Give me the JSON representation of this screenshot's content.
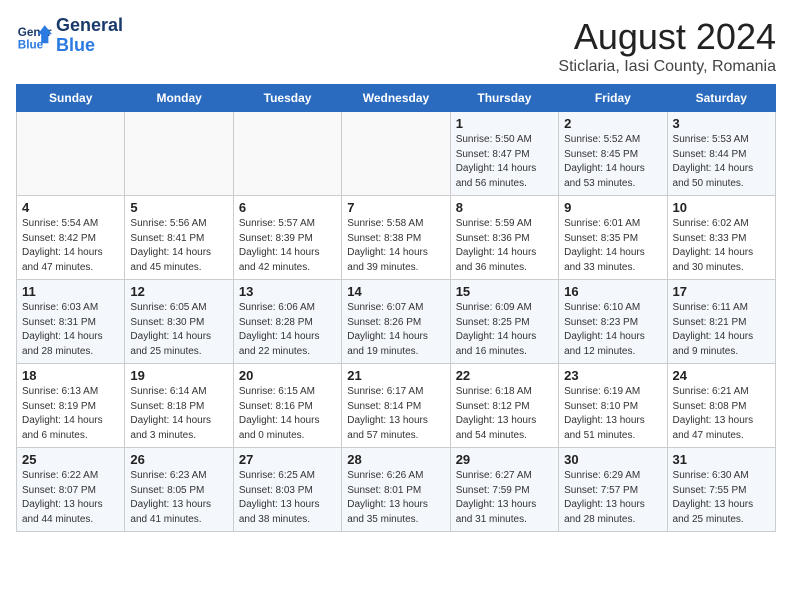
{
  "header": {
    "logo_line1": "General",
    "logo_line2": "Blue",
    "title": "August 2024",
    "subtitle": "Sticlaria, Iasi County, Romania"
  },
  "weekdays": [
    "Sunday",
    "Monday",
    "Tuesday",
    "Wednesday",
    "Thursday",
    "Friday",
    "Saturday"
  ],
  "weeks": [
    [
      {
        "num": "",
        "detail": ""
      },
      {
        "num": "",
        "detail": ""
      },
      {
        "num": "",
        "detail": ""
      },
      {
        "num": "",
        "detail": ""
      },
      {
        "num": "1",
        "detail": "Sunrise: 5:50 AM\nSunset: 8:47 PM\nDaylight: 14 hours\nand 56 minutes."
      },
      {
        "num": "2",
        "detail": "Sunrise: 5:52 AM\nSunset: 8:45 PM\nDaylight: 14 hours\nand 53 minutes."
      },
      {
        "num": "3",
        "detail": "Sunrise: 5:53 AM\nSunset: 8:44 PM\nDaylight: 14 hours\nand 50 minutes."
      }
    ],
    [
      {
        "num": "4",
        "detail": "Sunrise: 5:54 AM\nSunset: 8:42 PM\nDaylight: 14 hours\nand 47 minutes."
      },
      {
        "num": "5",
        "detail": "Sunrise: 5:56 AM\nSunset: 8:41 PM\nDaylight: 14 hours\nand 45 minutes."
      },
      {
        "num": "6",
        "detail": "Sunrise: 5:57 AM\nSunset: 8:39 PM\nDaylight: 14 hours\nand 42 minutes."
      },
      {
        "num": "7",
        "detail": "Sunrise: 5:58 AM\nSunset: 8:38 PM\nDaylight: 14 hours\nand 39 minutes."
      },
      {
        "num": "8",
        "detail": "Sunrise: 5:59 AM\nSunset: 8:36 PM\nDaylight: 14 hours\nand 36 minutes."
      },
      {
        "num": "9",
        "detail": "Sunrise: 6:01 AM\nSunset: 8:35 PM\nDaylight: 14 hours\nand 33 minutes."
      },
      {
        "num": "10",
        "detail": "Sunrise: 6:02 AM\nSunset: 8:33 PM\nDaylight: 14 hours\nand 30 minutes."
      }
    ],
    [
      {
        "num": "11",
        "detail": "Sunrise: 6:03 AM\nSunset: 8:31 PM\nDaylight: 14 hours\nand 28 minutes."
      },
      {
        "num": "12",
        "detail": "Sunrise: 6:05 AM\nSunset: 8:30 PM\nDaylight: 14 hours\nand 25 minutes."
      },
      {
        "num": "13",
        "detail": "Sunrise: 6:06 AM\nSunset: 8:28 PM\nDaylight: 14 hours\nand 22 minutes."
      },
      {
        "num": "14",
        "detail": "Sunrise: 6:07 AM\nSunset: 8:26 PM\nDaylight: 14 hours\nand 19 minutes."
      },
      {
        "num": "15",
        "detail": "Sunrise: 6:09 AM\nSunset: 8:25 PM\nDaylight: 14 hours\nand 16 minutes."
      },
      {
        "num": "16",
        "detail": "Sunrise: 6:10 AM\nSunset: 8:23 PM\nDaylight: 14 hours\nand 12 minutes."
      },
      {
        "num": "17",
        "detail": "Sunrise: 6:11 AM\nSunset: 8:21 PM\nDaylight: 14 hours\nand 9 minutes."
      }
    ],
    [
      {
        "num": "18",
        "detail": "Sunrise: 6:13 AM\nSunset: 8:19 PM\nDaylight: 14 hours\nand 6 minutes."
      },
      {
        "num": "19",
        "detail": "Sunrise: 6:14 AM\nSunset: 8:18 PM\nDaylight: 14 hours\nand 3 minutes."
      },
      {
        "num": "20",
        "detail": "Sunrise: 6:15 AM\nSunset: 8:16 PM\nDaylight: 14 hours and 0 minutes."
      },
      {
        "num": "21",
        "detail": "Sunrise: 6:17 AM\nSunset: 8:14 PM\nDaylight: 13 hours\nand 57 minutes."
      },
      {
        "num": "22",
        "detail": "Sunrise: 6:18 AM\nSunset: 8:12 PM\nDaylight: 13 hours\nand 54 minutes."
      },
      {
        "num": "23",
        "detail": "Sunrise: 6:19 AM\nSunset: 8:10 PM\nDaylight: 13 hours\nand 51 minutes."
      },
      {
        "num": "24",
        "detail": "Sunrise: 6:21 AM\nSunset: 8:08 PM\nDaylight: 13 hours\nand 47 minutes."
      }
    ],
    [
      {
        "num": "25",
        "detail": "Sunrise: 6:22 AM\nSunset: 8:07 PM\nDaylight: 13 hours\nand 44 minutes."
      },
      {
        "num": "26",
        "detail": "Sunrise: 6:23 AM\nSunset: 8:05 PM\nDaylight: 13 hours\nand 41 minutes."
      },
      {
        "num": "27",
        "detail": "Sunrise: 6:25 AM\nSunset: 8:03 PM\nDaylight: 13 hours\nand 38 minutes."
      },
      {
        "num": "28",
        "detail": "Sunrise: 6:26 AM\nSunset: 8:01 PM\nDaylight: 13 hours\nand 35 minutes."
      },
      {
        "num": "29",
        "detail": "Sunrise: 6:27 AM\nSunset: 7:59 PM\nDaylight: 13 hours\nand 31 minutes."
      },
      {
        "num": "30",
        "detail": "Sunrise: 6:29 AM\nSunset: 7:57 PM\nDaylight: 13 hours\nand 28 minutes."
      },
      {
        "num": "31",
        "detail": "Sunrise: 6:30 AM\nSunset: 7:55 PM\nDaylight: 13 hours\nand 25 minutes."
      }
    ]
  ]
}
